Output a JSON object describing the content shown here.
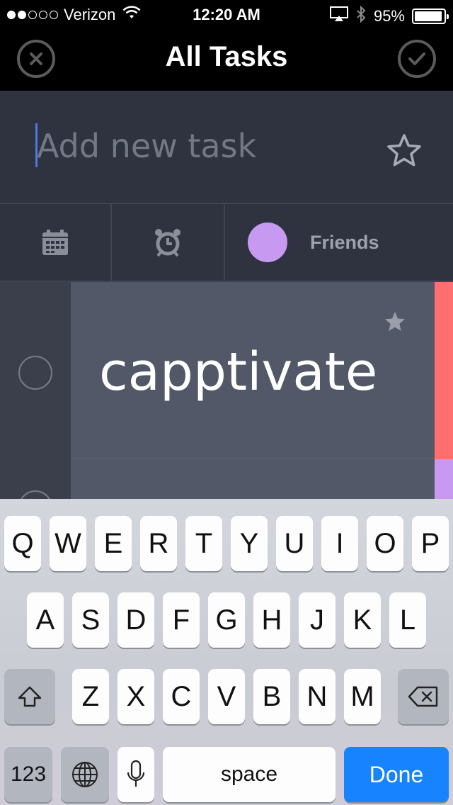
{
  "status_bar": {
    "carrier": "Verizon",
    "time": "12:20 AM",
    "battery": "95%",
    "battery_level": 0.95
  },
  "nav": {
    "title": "All Tasks",
    "left_icon": "close-circle-icon",
    "right_icon": "check-circle-icon"
  },
  "add_task": {
    "placeholder": "Add new task",
    "star_icon": "star-outline-icon"
  },
  "options": {
    "date_icon": "calendar-icon",
    "alarm_icon": "alarm-clock-icon",
    "list_name": "Friends",
    "list_color": "#c899f0"
  },
  "tasks": [
    {
      "title": "capptivate",
      "starred": true,
      "color": "#ff6f6f"
    },
    {
      "title": "",
      "starred": false,
      "color": "#c899f0"
    }
  ],
  "keyboard": {
    "row1": [
      "Q",
      "W",
      "E",
      "R",
      "T",
      "Y",
      "U",
      "I",
      "O",
      "P"
    ],
    "row2": [
      "A",
      "S",
      "D",
      "F",
      "G",
      "H",
      "J",
      "K",
      "L"
    ],
    "row3": [
      "Z",
      "X",
      "C",
      "V",
      "B",
      "N",
      "M"
    ],
    "numbers_label": "123",
    "space_label": "space",
    "done_label": "Done",
    "accent": "#1783ff"
  }
}
